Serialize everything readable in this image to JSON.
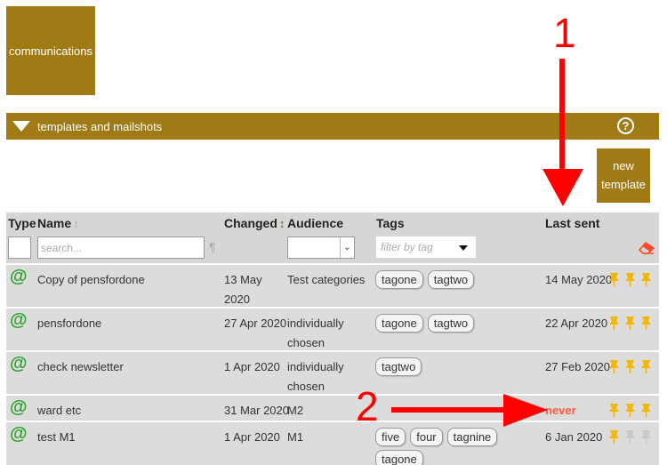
{
  "communications_label": "communications",
  "section": {
    "title": "templates and mailshots",
    "help": "?"
  },
  "new_template": {
    "line1": "new",
    "line2": "template"
  },
  "headers": {
    "type": "Type",
    "name": "Name",
    "changed": "Changed",
    "audience": "Audience",
    "tags": "Tags",
    "last_sent": "Last sent"
  },
  "filters": {
    "search_placeholder": "search...",
    "tag_placeholder": "filter by tag",
    "pilcrow": "¶"
  },
  "rows": [
    {
      "name": "Copy of pensfordone",
      "changed": [
        "13 May",
        "2020"
      ],
      "audience": [
        "Test categories"
      ],
      "tags": [
        "tagone",
        "tagtwo"
      ],
      "last_sent": "14 May 2020",
      "pins": [
        1,
        1,
        1
      ]
    },
    {
      "name": "pensfordone",
      "changed": [
        "27 Apr 2020"
      ],
      "audience": [
        "individually",
        "chosen"
      ],
      "tags": [
        "tagone",
        "tagtwo"
      ],
      "last_sent": "22 Apr 2020",
      "pins": [
        1,
        1,
        1
      ]
    },
    {
      "name": "check newsletter",
      "changed": [
        "1 Apr 2020"
      ],
      "audience": [
        "individually",
        "chosen"
      ],
      "tags": [
        "tagtwo"
      ],
      "last_sent": "27 Feb 2020",
      "pins": [
        1,
        1,
        1
      ]
    },
    {
      "name": "ward etc",
      "changed": [
        "31 Mar 2020"
      ],
      "audience": [
        "M2"
      ],
      "tags": [],
      "last_sent": "never",
      "pins": [
        1,
        1,
        1
      ]
    },
    {
      "name": "test M1",
      "changed": [
        "1 Apr 2020"
      ],
      "audience": [
        "M1"
      ],
      "tags": [
        "five",
        "four",
        "tagnine",
        "tagone"
      ],
      "last_sent": "6 Jan 2020",
      "pins": [
        1,
        0,
        0
      ]
    }
  ],
  "annotations": {
    "one": "1",
    "two": "2"
  },
  "colors": {
    "brand": "#a07a14",
    "pin_active": "#f2b705",
    "pin_inactive": "#c8c8c8",
    "never": "#ff5a3c",
    "arrow": "#ff0000"
  }
}
